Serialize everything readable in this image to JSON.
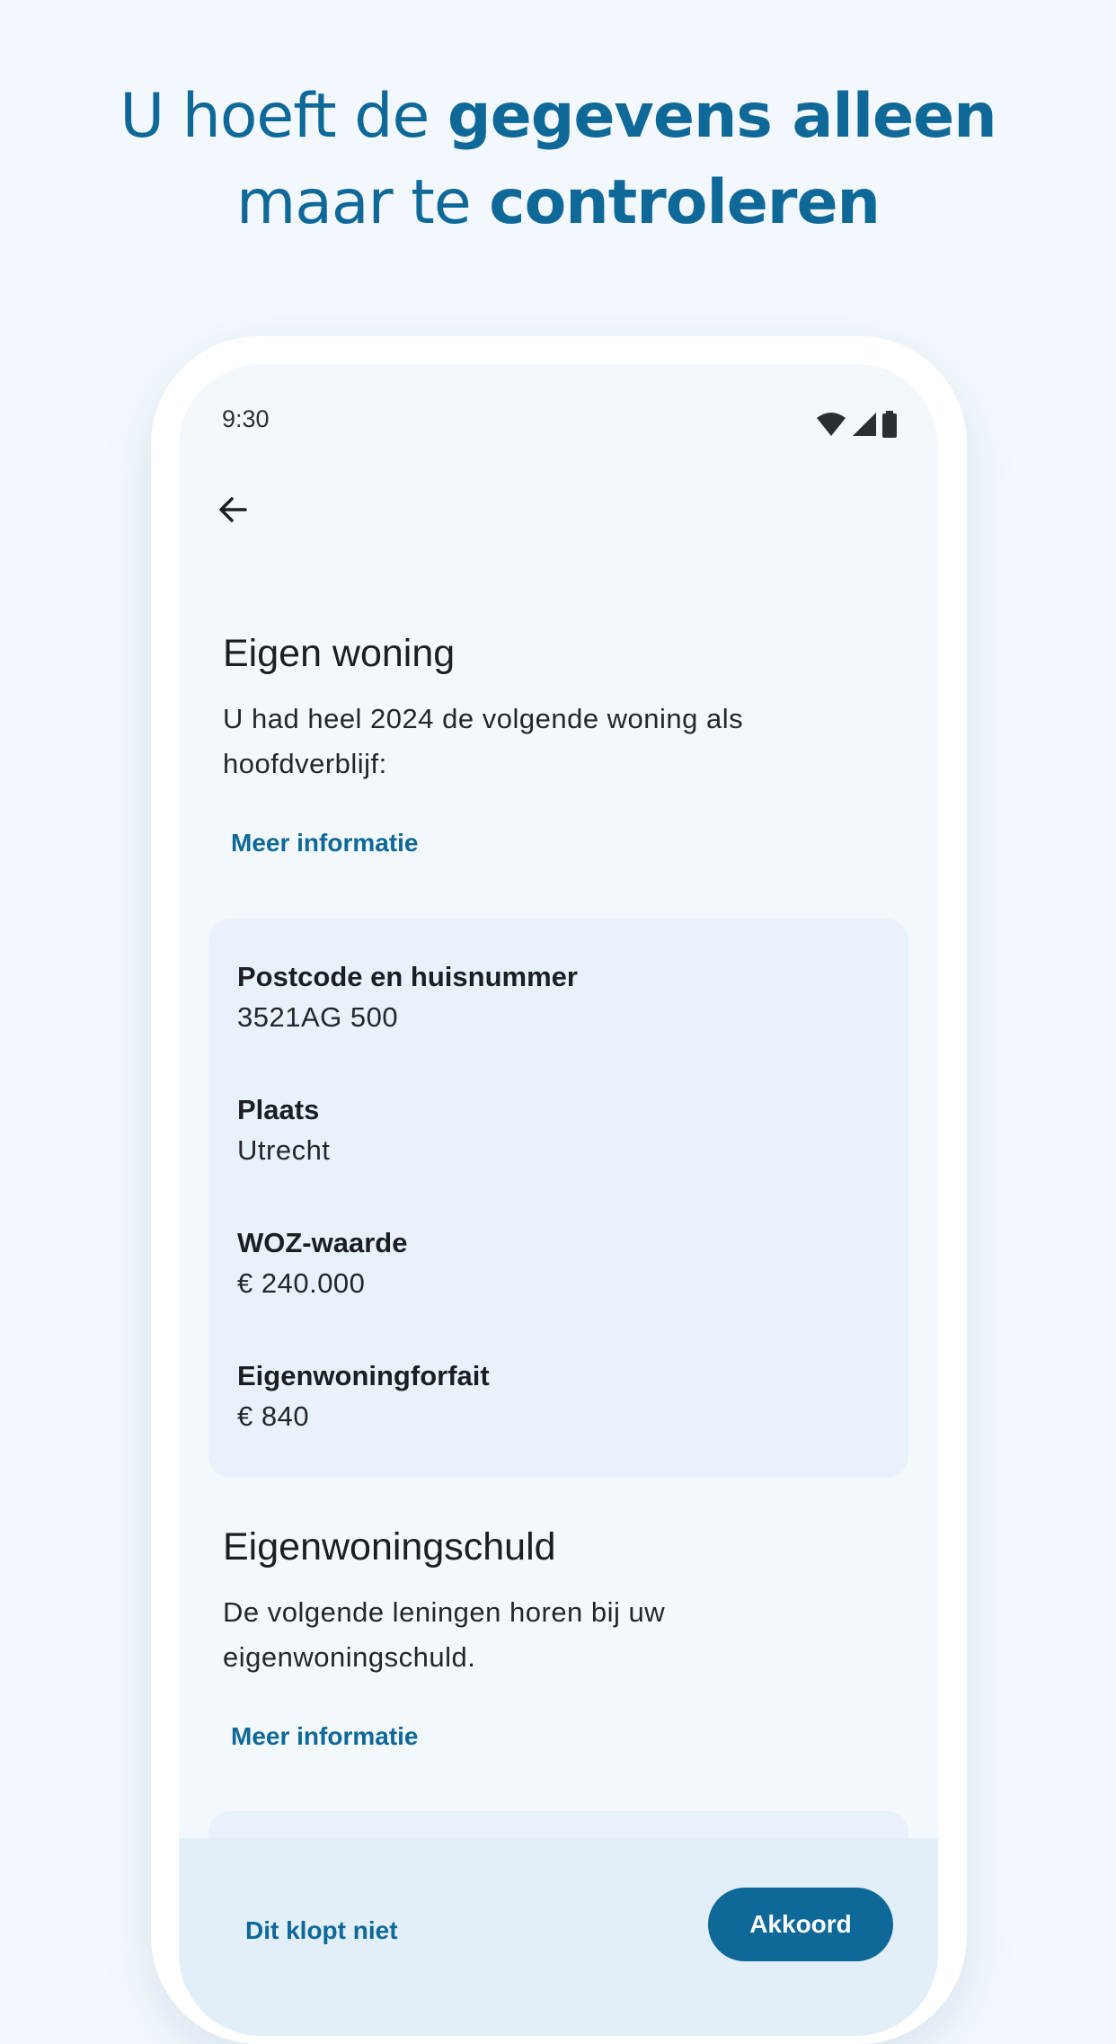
{
  "headline": {
    "line1_regular": "U hoeft de ",
    "line1_bold": "gegevens alleen",
    "line2_regular": "maar te ",
    "line2_bold": "controleren"
  },
  "status_bar": {
    "time": "9:30",
    "icons": [
      "wifi-icon",
      "signal-icon",
      "battery-icon"
    ]
  },
  "app_bar": {
    "back_icon": "arrow-left-icon"
  },
  "eigen_woning": {
    "title": "Eigen woning",
    "description": "U had heel 2024 de volgende woning als hoofdverblijf:",
    "more_info": "Meer informatie",
    "fields": [
      {
        "label": "Postcode en huisnummer",
        "value": "3521AG 500"
      },
      {
        "label": "Plaats",
        "value": "Utrecht"
      },
      {
        "label": "WOZ-waarde",
        "value": "€ 240.000"
      },
      {
        "label": "Eigenwoningforfait",
        "value": "€ 840"
      }
    ]
  },
  "eigenwoningschuld": {
    "title": "Eigenwoningschuld",
    "description": "De volgende leningen horen bij uw eigenwoningschuld.",
    "more_info": "Meer informatie"
  },
  "bottom_bar": {
    "secondary": "Dit klopt niet",
    "primary": "Akkoord"
  },
  "colors": {
    "accent": "#0e6898",
    "background": "#f2f8fd",
    "card": "#e9f2fa"
  }
}
